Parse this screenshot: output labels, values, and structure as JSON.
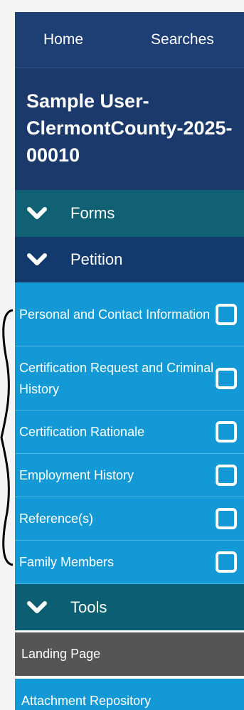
{
  "nav": {
    "home": "Home",
    "searches": "Searches"
  },
  "user_title": "Sample User-ClermontCounty-2025-00010",
  "sections": {
    "forms": "Forms",
    "petition": "Petition",
    "tools": "Tools"
  },
  "petition_items": [
    "Personal and Contact Information",
    "Certification Request and Criminal History",
    "Certification Rationale",
    "Employment History",
    "Reference(s)",
    "Family Members"
  ],
  "tools_items": {
    "landing_page": "Landing Page",
    "attachment_repository": "Attachment Repository"
  },
  "colors": {
    "nav_bg": "#1e3f74",
    "forms_bg": "#0f6173",
    "petition_bg": "#123a6c",
    "item_bg": "#1399d6",
    "landing_bg": "#555555"
  },
  "icons": {
    "section": "chevron-down-icon",
    "item_status": "checkbox-icon"
  }
}
